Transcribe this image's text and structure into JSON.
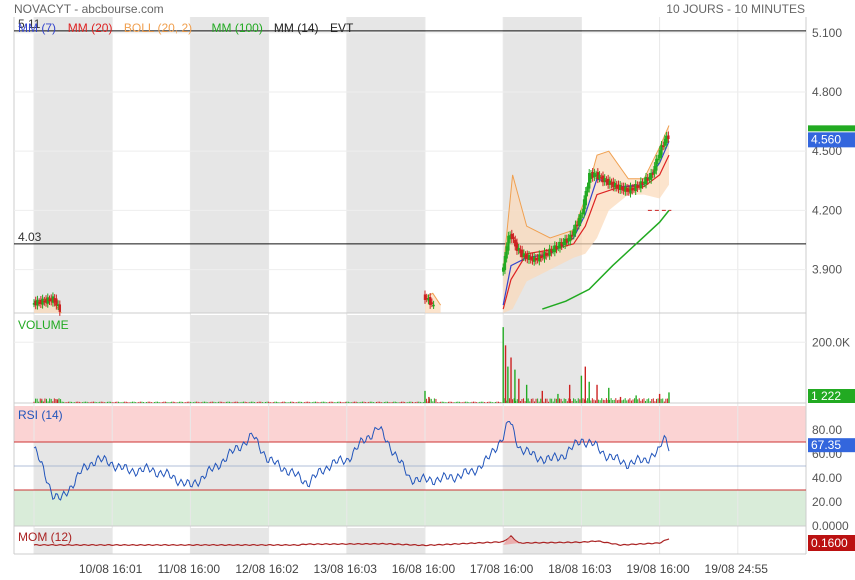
{
  "header": {
    "symbol_source": "NOVACYT - abcbourse.com",
    "period": "10 JOURS - 10 MINUTES"
  },
  "legend": [
    {
      "label": "MM (7)",
      "color": "#3344cc"
    },
    {
      "label": "MM (20)",
      "color": "#dd2222"
    },
    {
      "label": "BOLL (20, 2)",
      "color": "#f0a050"
    },
    {
      "label": "MM (100)",
      "color": "#22aa22"
    },
    {
      "label": "MM (14)",
      "color": "#222222"
    },
    {
      "label": "EVT",
      "color": "#222222"
    }
  ],
  "colors": {
    "shade": "#e6e6e6",
    "candle_up": "#22aa22",
    "candle_down": "#cc2222",
    "boll_fill": "#fbd9b8",
    "boll_line": "#f0a050",
    "rsi_high_zone": "#fbd3d3",
    "rsi_low_zone": "#d9ecd9",
    "rsi_line": "#2255bb",
    "mom_line": "#aa2222",
    "price_badge": "#3366dd",
    "volume_badge": "#22aa22",
    "mom_badge": "#bb1111"
  },
  "chart_data": [
    {
      "type": "candlestick",
      "panel": "price",
      "x_ticks": [
        "10/08 16:01",
        "11/08 16:00",
        "12/08 16:02",
        "13/08 16:03",
        "16/08 16:00",
        "17/08 16:00",
        "18/08 16:03",
        "19/08 16:00",
        "19/08 24:55"
      ],
      "y_ticks": [
        "5.100",
        "4.800",
        "4.500",
        "4.200",
        "3.900"
      ],
      "ylim": [
        3.68,
        5.18
      ],
      "hlines": [
        {
          "label": "5.11",
          "value": 5.11
        },
        {
          "label": "4.03",
          "value": 4.03
        }
      ],
      "last_price_label": "4.560",
      "last_price": 4.56,
      "session_breaks_day": [
        1,
        2,
        3,
        4,
        5,
        6,
        7,
        8
      ],
      "close_series": [
        {
          "day": 0.0,
          "price": 3.73
        },
        {
          "day": 0.25,
          "price": 3.75
        },
        {
          "day": 0.35,
          "price": 3.68
        },
        {
          "day": 5.0,
          "price": 3.76
        },
        {
          "day": 5.08,
          "price": 3.73
        },
        {
          "day": 5.13,
          "price": 3.7
        },
        {
          "day": 6.0,
          "price": 3.9
        },
        {
          "day": 6.05,
          "price": 4.05
        },
        {
          "day": 6.1,
          "price": 4.08
        },
        {
          "day": 6.15,
          "price": 4.02
        },
        {
          "day": 6.25,
          "price": 3.97
        },
        {
          "day": 6.4,
          "price": 3.95
        },
        {
          "day": 6.55,
          "price": 3.98
        },
        {
          "day": 6.7,
          "price": 4.02
        },
        {
          "day": 6.85,
          "price": 4.06
        },
        {
          "day": 7.0,
          "price": 4.18
        },
        {
          "day": 7.1,
          "price": 4.38
        },
        {
          "day": 7.18,
          "price": 4.38
        },
        {
          "day": 7.3,
          "price": 4.35
        },
        {
          "day": 7.45,
          "price": 4.32
        },
        {
          "day": 7.6,
          "price": 4.3
        },
        {
          "day": 7.75,
          "price": 4.33
        },
        {
          "day": 7.9,
          "price": 4.38
        },
        {
          "day": 8.0,
          "price": 4.5
        },
        {
          "day": 8.07,
          "price": 4.56
        },
        {
          "day": 8.12,
          "price": 4.58
        }
      ],
      "mm7": [
        {
          "day": 6.0,
          "price": 3.72
        },
        {
          "day": 6.1,
          "price": 3.92
        },
        {
          "day": 6.3,
          "price": 3.96
        },
        {
          "day": 6.6,
          "price": 3.98
        },
        {
          "day": 6.9,
          "price": 4.06
        },
        {
          "day": 7.05,
          "price": 4.18
        },
        {
          "day": 7.2,
          "price": 4.36
        },
        {
          "day": 7.5,
          "price": 4.32
        },
        {
          "day": 7.8,
          "price": 4.33
        },
        {
          "day": 8.0,
          "price": 4.44
        },
        {
          "day": 8.12,
          "price": 4.55
        }
      ],
      "mm20": [
        {
          "day": 6.0,
          "price": 3.7
        },
        {
          "day": 6.1,
          "price": 3.85
        },
        {
          "day": 6.3,
          "price": 3.98
        },
        {
          "day": 6.6,
          "price": 4.0
        },
        {
          "day": 6.9,
          "price": 4.03
        },
        {
          "day": 7.05,
          "price": 4.12
        },
        {
          "day": 7.2,
          "price": 4.28
        },
        {
          "day": 7.5,
          "price": 4.32
        },
        {
          "day": 7.8,
          "price": 4.32
        },
        {
          "day": 8.0,
          "price": 4.38
        },
        {
          "day": 8.12,
          "price": 4.48
        }
      ],
      "mm100": [
        {
          "day": 6.5,
          "price": 3.7
        },
        {
          "day": 6.8,
          "price": 3.74
        },
        {
          "day": 7.1,
          "price": 3.8
        },
        {
          "day": 7.4,
          "price": 3.92
        },
        {
          "day": 7.7,
          "price": 4.03
        },
        {
          "day": 8.0,
          "price": 4.14
        },
        {
          "day": 8.12,
          "price": 4.2
        }
      ],
      "boll_upper": [
        {
          "day": 0.0,
          "price": 3.73
        },
        {
          "day": 0.2,
          "price": 3.76
        },
        {
          "day": 0.35,
          "price": 3.68
        },
        {
          "day": 5.0,
          "price": 3.76
        },
        {
          "day": 5.1,
          "price": 3.78
        },
        {
          "day": 5.2,
          "price": 3.72
        },
        {
          "day": 6.0,
          "price": 3.9
        },
        {
          "day": 6.12,
          "price": 4.38
        },
        {
          "day": 6.3,
          "price": 4.12
        },
        {
          "day": 6.6,
          "price": 4.06
        },
        {
          "day": 6.9,
          "price": 4.1
        },
        {
          "day": 7.05,
          "price": 4.26
        },
        {
          "day": 7.2,
          "price": 4.48
        },
        {
          "day": 7.35,
          "price": 4.5
        },
        {
          "day": 7.6,
          "price": 4.36
        },
        {
          "day": 7.8,
          "price": 4.36
        },
        {
          "day": 8.0,
          "price": 4.52
        },
        {
          "day": 8.12,
          "price": 4.63
        }
      ],
      "boll_lower": [
        {
          "day": 0.0,
          "price": 3.68
        },
        {
          "day": 0.35,
          "price": 3.68
        },
        {
          "day": 5.0,
          "price": 3.68
        },
        {
          "day": 5.2,
          "price": 3.68
        },
        {
          "day": 6.0,
          "price": 3.68
        },
        {
          "day": 6.12,
          "price": 3.7
        },
        {
          "day": 6.3,
          "price": 3.84
        },
        {
          "day": 6.6,
          "price": 3.9
        },
        {
          "day": 6.9,
          "price": 3.96
        },
        {
          "day": 7.05,
          "price": 3.98
        },
        {
          "day": 7.2,
          "price": 4.06
        },
        {
          "day": 7.35,
          "price": 4.2
        },
        {
          "day": 7.6,
          "price": 4.28
        },
        {
          "day": 7.8,
          "price": 4.28
        },
        {
          "day": 8.0,
          "price": 4.26
        },
        {
          "day": 8.12,
          "price": 4.33
        }
      ]
    },
    {
      "type": "bar",
      "panel": "volume",
      "title": "VOLUME",
      "y_ticks": [
        "200.0K"
      ],
      "ylim": [
        0,
        290000
      ],
      "last_value_label": "1 222",
      "spikes": [
        {
          "day": 0.1,
          "value": 8000
        },
        {
          "day": 0.3,
          "value": 12000
        },
        {
          "day": 5.0,
          "value": 40000
        },
        {
          "day": 5.05,
          "value": 20000
        },
        {
          "day": 6.0,
          "value": 250000
        },
        {
          "day": 6.03,
          "value": 190000
        },
        {
          "day": 6.06,
          "value": 120000
        },
        {
          "day": 6.1,
          "value": 150000
        },
        {
          "day": 6.15,
          "value": 110000
        },
        {
          "day": 6.2,
          "value": 80000
        },
        {
          "day": 6.3,
          "value": 60000
        },
        {
          "day": 6.5,
          "value": 40000
        },
        {
          "day": 6.7,
          "value": 30000
        },
        {
          "day": 6.85,
          "value": 60000
        },
        {
          "day": 7.0,
          "value": 90000
        },
        {
          "day": 7.05,
          "value": 120000
        },
        {
          "day": 7.1,
          "value": 70000
        },
        {
          "day": 7.2,
          "value": 60000
        },
        {
          "day": 7.35,
          "value": 50000
        },
        {
          "day": 7.5,
          "value": 20000
        },
        {
          "day": 7.7,
          "value": 25000
        },
        {
          "day": 8.0,
          "value": 30000
        },
        {
          "day": 8.12,
          "value": 35000
        }
      ]
    },
    {
      "type": "line",
      "panel": "rsi",
      "title": "RSI (14)",
      "y_ticks": [
        "80.00",
        "60.00",
        "40.00",
        "20.00",
        "0.0000"
      ],
      "ylim": [
        0,
        100
      ],
      "zones": {
        "high": 70,
        "low": 30
      },
      "last_value_label": "67.35",
      "points": [
        {
          "day": 0.0,
          "rsi": 65
        },
        {
          "day": 0.1,
          "rsi": 50
        },
        {
          "day": 0.25,
          "rsi": 25
        },
        {
          "day": 0.35,
          "rsi": 22
        },
        {
          "day": 0.6,
          "rsi": 45
        },
        {
          "day": 0.8,
          "rsi": 56
        },
        {
          "day": 1.0,
          "rsi": 52
        },
        {
          "day": 1.2,
          "rsi": 46
        },
        {
          "day": 1.5,
          "rsi": 47
        },
        {
          "day": 1.8,
          "rsi": 40
        },
        {
          "day": 2.0,
          "rsi": 33
        },
        {
          "day": 2.3,
          "rsi": 48
        },
        {
          "day": 2.6,
          "rsi": 65
        },
        {
          "day": 2.8,
          "rsi": 75
        },
        {
          "day": 3.0,
          "rsi": 55
        },
        {
          "day": 3.2,
          "rsi": 48
        },
        {
          "day": 3.5,
          "rsi": 36
        },
        {
          "day": 3.8,
          "rsi": 52
        },
        {
          "day": 4.0,
          "rsi": 55
        },
        {
          "day": 4.2,
          "rsi": 70
        },
        {
          "day": 4.4,
          "rsi": 82
        },
        {
          "day": 4.6,
          "rsi": 62
        },
        {
          "day": 4.8,
          "rsi": 40
        },
        {
          "day": 5.0,
          "rsi": 38
        },
        {
          "day": 5.3,
          "rsi": 40
        },
        {
          "day": 5.6,
          "rsi": 45
        },
        {
          "day": 5.8,
          "rsi": 55
        },
        {
          "day": 6.0,
          "rsi": 75
        },
        {
          "day": 6.08,
          "rsi": 88
        },
        {
          "day": 6.2,
          "rsi": 66
        },
        {
          "day": 6.4,
          "rsi": 58
        },
        {
          "day": 6.6,
          "rsi": 55
        },
        {
          "day": 6.8,
          "rsi": 60
        },
        {
          "day": 7.0,
          "rsi": 72
        },
        {
          "day": 7.15,
          "rsi": 68
        },
        {
          "day": 7.3,
          "rsi": 60
        },
        {
          "day": 7.45,
          "rsi": 55
        },
        {
          "day": 7.6,
          "rsi": 52
        },
        {
          "day": 7.8,
          "rsi": 55
        },
        {
          "day": 8.0,
          "rsi": 62
        },
        {
          "day": 8.05,
          "rsi": 75
        },
        {
          "day": 8.12,
          "rsi": 67.35
        }
      ]
    },
    {
      "type": "line",
      "panel": "momentum",
      "title": "MOM (12)",
      "last_value_label": "0.1600",
      "points": [
        {
          "day": 0.0,
          "mom": 0.0
        },
        {
          "day": 3.4,
          "mom": 0.0
        },
        {
          "day": 3.45,
          "mom": 0.02
        },
        {
          "day": 4.5,
          "mom": 0.03
        },
        {
          "day": 5.0,
          "mom": -0.01
        },
        {
          "day": 6.0,
          "mom": 0.08
        },
        {
          "day": 6.1,
          "mom": 0.22
        },
        {
          "day": 6.2,
          "mom": 0.05
        },
        {
          "day": 7.0,
          "mom": 0.07
        },
        {
          "day": 7.2,
          "mom": 0.1
        },
        {
          "day": 7.5,
          "mom": 0.0
        },
        {
          "day": 8.0,
          "mom": 0.05
        },
        {
          "day": 8.12,
          "mom": 0.16
        }
      ]
    }
  ]
}
